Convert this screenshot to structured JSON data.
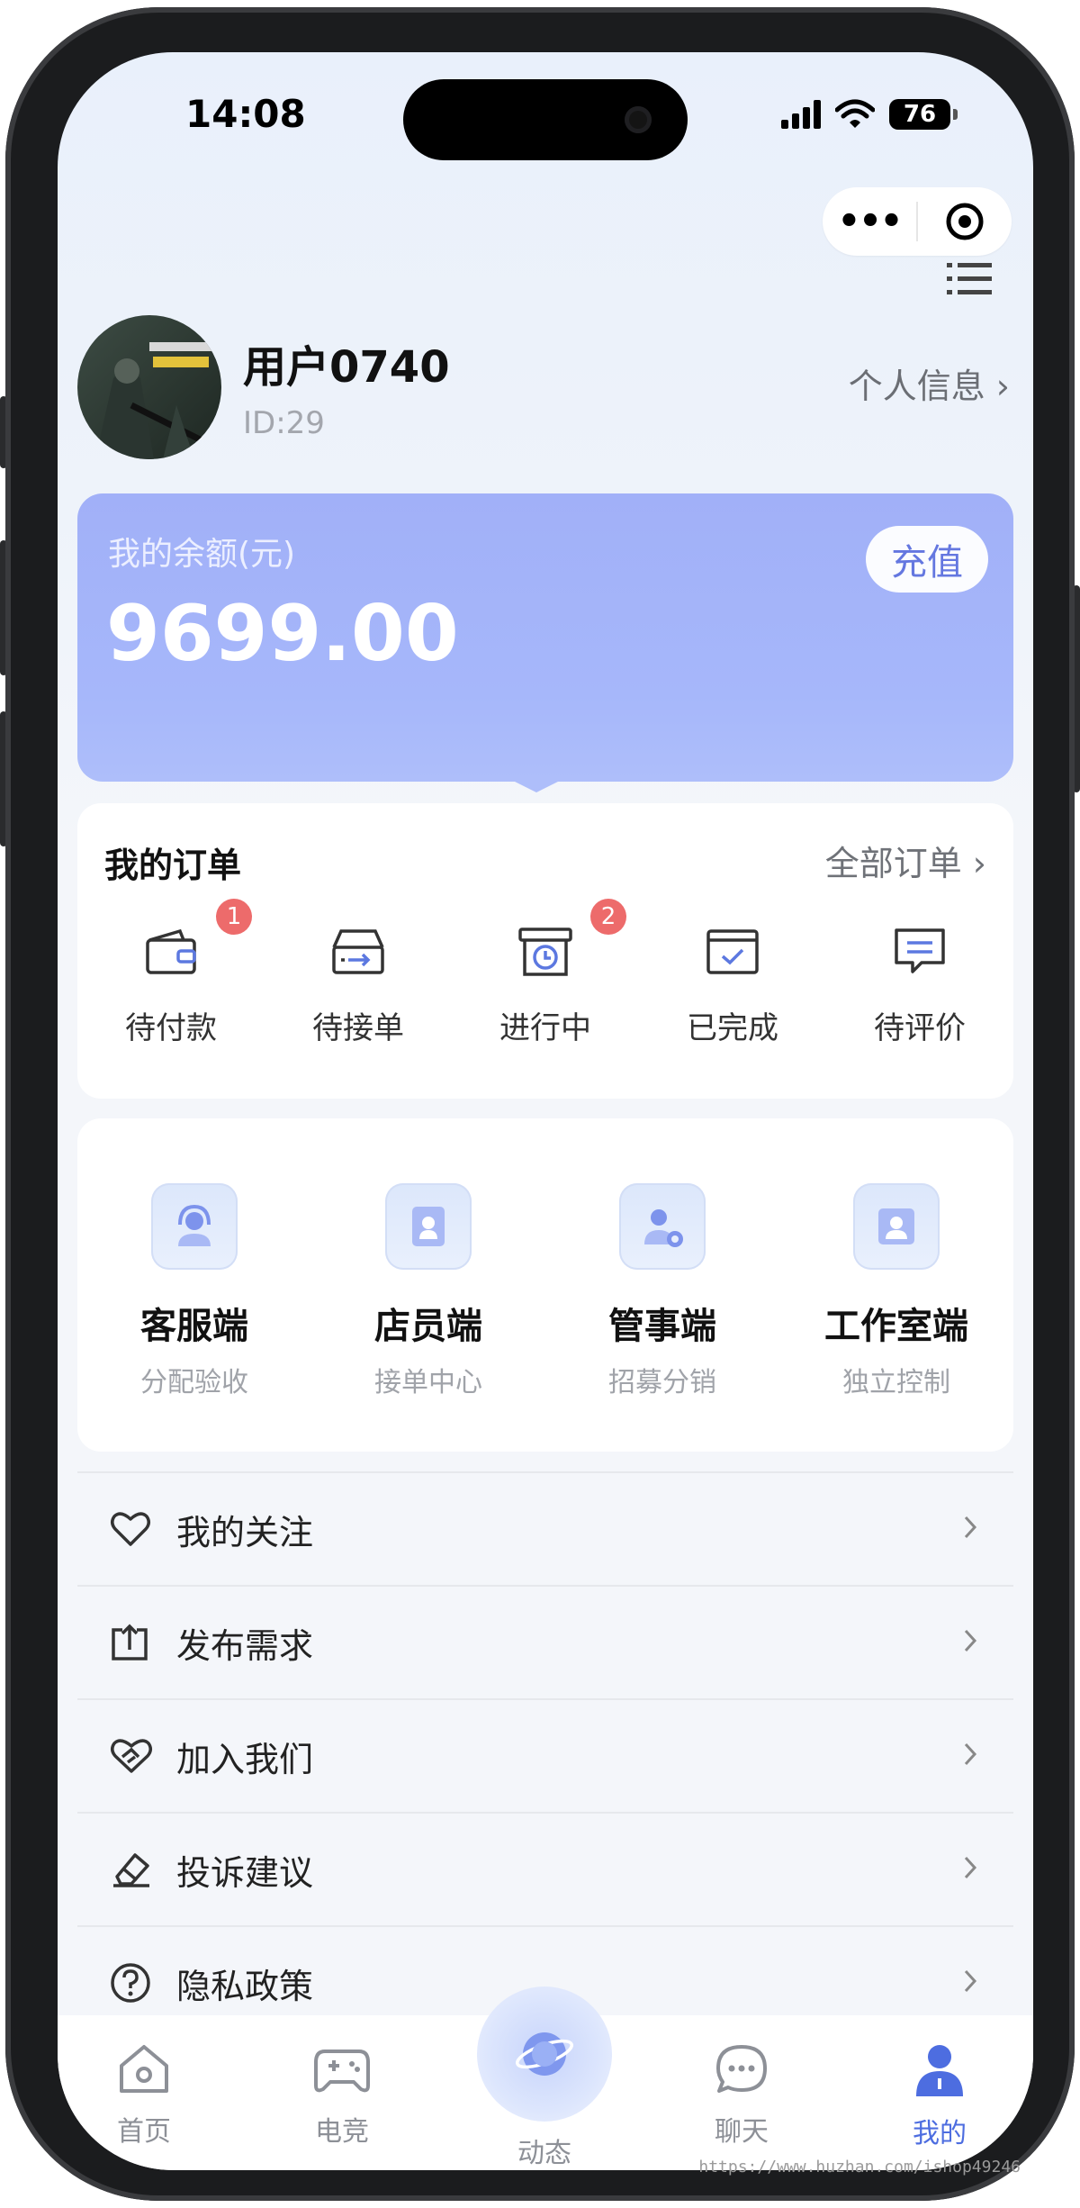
{
  "status_bar": {
    "time": "14:08",
    "battery": "76"
  },
  "header": {
    "username": "用户0740",
    "user_id": "ID:29",
    "profile_link": "个人信息 ›"
  },
  "balance": {
    "label": "我的余额(元)",
    "amount": "9699.00",
    "recharge_label": "充值"
  },
  "orders": {
    "title": "我的订单",
    "all_label": "全部订单 ›",
    "items": [
      {
        "label": "待付款",
        "badge": "1",
        "icon": "wallet-icon"
      },
      {
        "label": "待接单",
        "badge": "",
        "icon": "inbox-arrow-icon"
      },
      {
        "label": "进行中",
        "badge": "2",
        "icon": "clock-box-icon"
      },
      {
        "label": "已完成",
        "badge": "",
        "icon": "checked-box-icon"
      },
      {
        "label": "待评价",
        "badge": "",
        "icon": "comment-icon"
      }
    ]
  },
  "roles": [
    {
      "name": "客服端",
      "sub": "分配验收",
      "icon": "headset-icon"
    },
    {
      "name": "店员端",
      "sub": "接单中心",
      "icon": "clerk-card-icon"
    },
    {
      "name": "管事端",
      "sub": "招募分销",
      "icon": "manager-gear-icon"
    },
    {
      "name": "工作室端",
      "sub": "独立控制",
      "icon": "studio-card-icon"
    }
  ],
  "menu": [
    {
      "label": "我的关注",
      "icon": "heart-icon"
    },
    {
      "label": "发布需求",
      "icon": "upload-icon"
    },
    {
      "label": "加入我们",
      "icon": "handshake-heart-icon"
    },
    {
      "label": "投诉建议",
      "icon": "eraser-icon"
    },
    {
      "label": "隐私政策",
      "icon": "question-circle-icon"
    }
  ],
  "tabbar": {
    "tabs": [
      {
        "label": "首页",
        "icon": "home-icon"
      },
      {
        "label": "电竞",
        "icon": "gamepad-icon"
      },
      {
        "label": "动态",
        "icon": "planet-icon"
      },
      {
        "label": "聊天",
        "icon": "chat-bubble-icon"
      },
      {
        "label": "我的",
        "icon": "person-icon"
      }
    ],
    "active": "我的"
  },
  "colors": {
    "accent": "#4d6de0",
    "balance_card": "#a6b7fa",
    "badge": "#ed6b6b"
  },
  "watermark": "https://www.huzhan.com/ishop49246"
}
